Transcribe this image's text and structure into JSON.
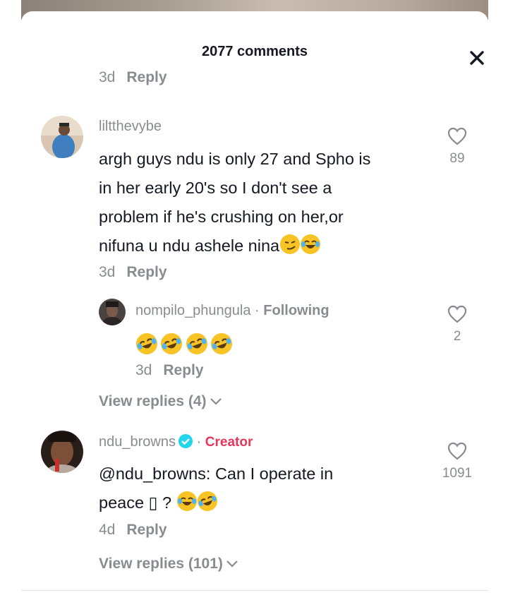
{
  "header": {
    "title": "2077 comments"
  },
  "top_reply": {
    "time": "3d",
    "reply": "Reply"
  },
  "comment1": {
    "username": "liltthevybe",
    "text_lines": [
      "argh guys ndu is only 27 and Spho is",
      "in her early 20's so I don't see a",
      "problem if he's crushing on her,or",
      "nifuna u ndu ashele nina"
    ],
    "time": "3d",
    "reply": "Reply",
    "likes": "89"
  },
  "reply1": {
    "username": "nompilo_phungula",
    "separator": "·",
    "tag": "Following",
    "time": "3d",
    "reply": "Reply",
    "likes": "2"
  },
  "view_replies_1": "View replies (4)",
  "comment2": {
    "username": "ndu_browns",
    "separator": "·",
    "tag": "Creator",
    "line1": "@ndu_browns:  Can I operate in",
    "line2": "peace ▯ ?",
    "time": "4d",
    "reply": "Reply",
    "likes": "1091"
  },
  "view_replies_2": "View replies (101)",
  "colors": {
    "creator": "#e8365a",
    "muted": "#8a8b91",
    "text": "#161823",
    "verified": "#20d5ec"
  },
  "icons": [
    "close-icon",
    "heart-outline-icon",
    "chevron-down-icon",
    "verified-badge-icon",
    "smirk-emoji",
    "joy-emoji",
    "rofl-emoji"
  ]
}
